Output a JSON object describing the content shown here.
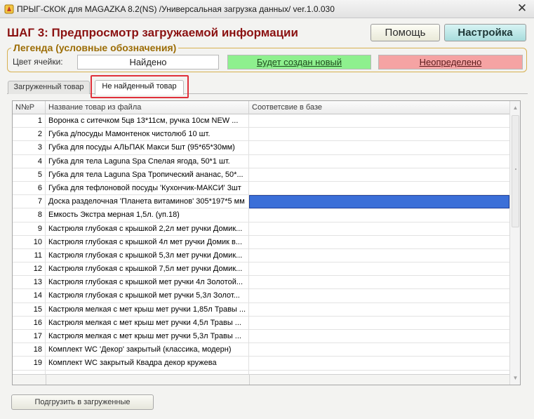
{
  "window": {
    "title": "ПРЫГ-СКОК для MAGAZKA 8.2(NS)  /Универсальная загрузка данных/ ver.1.0.030",
    "close_symbol": "✕"
  },
  "header": {
    "step_title": "ШАГ 3: Предпросмотр загружаемой информации",
    "help_label": "Помощь",
    "settings_label": "Настройка"
  },
  "legend": {
    "title": "Легенда (условные обозначения)",
    "cell_color_label": "Цвет ячейки:",
    "found": "Найдено",
    "will_create": "Будет создан новый",
    "undefined": "Неопределено",
    "colors": {
      "found": "#ffffff",
      "will_create": "#8ef08e",
      "undefined": "#f5a3a3",
      "selection": "#3b6fd8"
    }
  },
  "tabs": [
    {
      "label": "Загруженный товар",
      "active": false
    },
    {
      "label": "Не найденный товар",
      "active": true
    }
  ],
  "grid": {
    "columns": [
      "N№Р",
      "Название товар из файла",
      "Соответсвие в базе"
    ],
    "selected_row": 7,
    "rows": [
      {
        "num": "1",
        "name": "Воронка с ситечком 5цв 13*11см, ручка 10см NEW ...",
        "match": ""
      },
      {
        "num": "2",
        "name": "Губка д/посуды Мамонтенок чистолюб 10 шт.",
        "match": ""
      },
      {
        "num": "3",
        "name": "Губка для посуды АЛЬПАК Макси 5шт (95*65*30мм)",
        "match": ""
      },
      {
        "num": "4",
        "name": "Губка для тела Laguna Spa Спелая ягода, 50*1 шт.",
        "match": ""
      },
      {
        "num": "5",
        "name": "Губка для тела Laguna Spa Тропический ананас, 50*...",
        "match": ""
      },
      {
        "num": "6",
        "name": "Губка для тефлоновой посуды 'Кухончик-МАКСИ' 3шт",
        "match": ""
      },
      {
        "num": "7",
        "name": "Доска разделочная 'Планета витаминов' 305*197*5 мм",
        "match": ""
      },
      {
        "num": "8",
        "name": "Емкость Экстра мерная 1,5л. (уп.18)",
        "match": ""
      },
      {
        "num": "9",
        "name": "Кастрюля глубокая с крышкой 2,2л мет ручки Домик...",
        "match": ""
      },
      {
        "num": "10",
        "name": "Кастрюля глубокая с крышкой 4л мет ручки Домик в...",
        "match": ""
      },
      {
        "num": "11",
        "name": "Кастрюля глубокая с крышкой 5,3л мет ручки Домик...",
        "match": ""
      },
      {
        "num": "12",
        "name": "Кастрюля глубокая с крышкой 7,5л мет ручки Домик...",
        "match": ""
      },
      {
        "num": "13",
        "name": "Кастрюля глубокая с крышкой мет ручки 4л Золотой...",
        "match": ""
      },
      {
        "num": "14",
        "name": "Кастрюля глубокая с крышкой мет ручки 5,3л Золот...",
        "match": ""
      },
      {
        "num": "15",
        "name": "Кастрюля мелкая с мет крыш мет ручки 1,85л Травы ...",
        "match": ""
      },
      {
        "num": "16",
        "name": "Кастрюля мелкая с мет крыш мет ручки 4,5л Травы ...",
        "match": ""
      },
      {
        "num": "17",
        "name": "Кастрюля мелкая с мет крыш мет ручки 5,3л Травы ...",
        "match": ""
      },
      {
        "num": "18",
        "name": "Комплект WC 'Декор' закрытый (классика, модерн)",
        "match": ""
      },
      {
        "num": "19",
        "name": "Комплект WC закрытый Квадра декор кружева",
        "match": ""
      },
      {
        "num": "",
        "name": "",
        "match": ""
      }
    ]
  },
  "footer": {
    "pull_button_label": "Подгрузить в загруженные"
  }
}
